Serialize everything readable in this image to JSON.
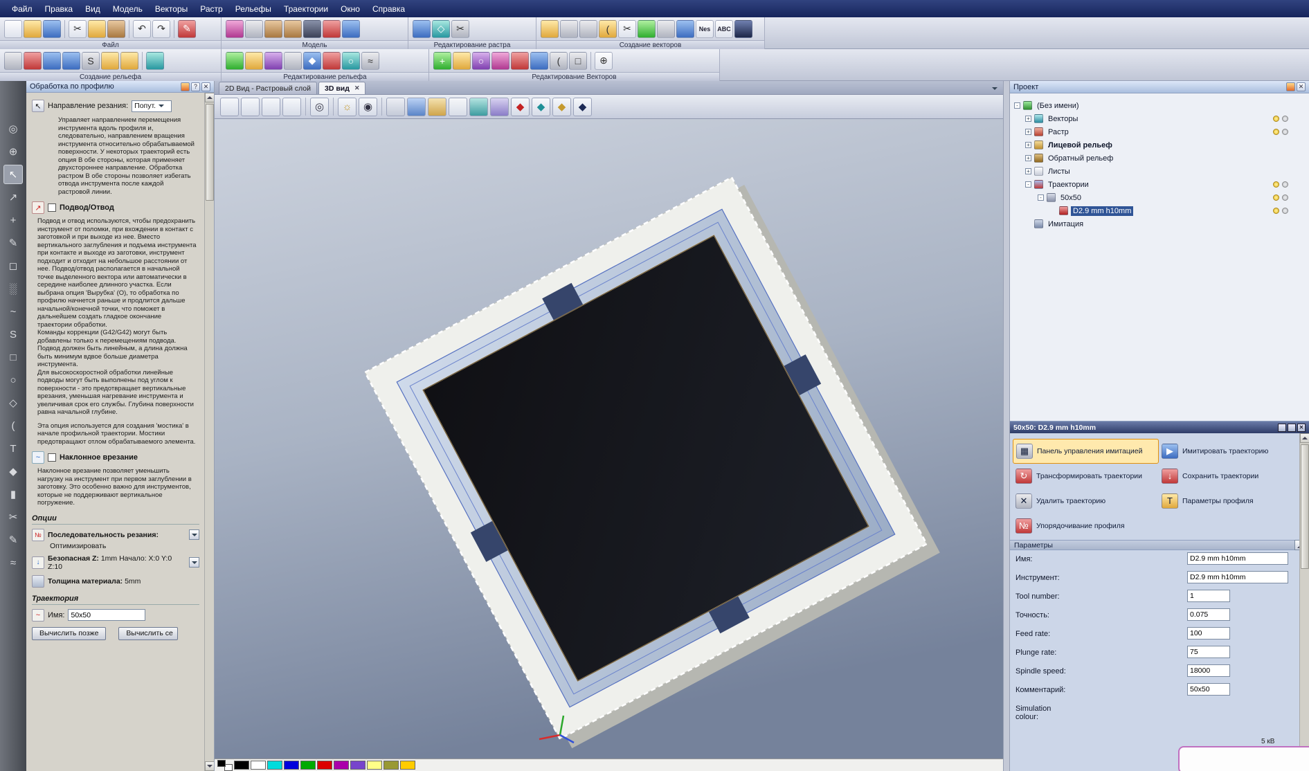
{
  "window": {
    "popup_text": "5 кВ"
  },
  "icons": {
    "close": "✕",
    "help": "?",
    "zoom": "◎",
    "orbit": "⊕",
    "select": "↖",
    "transform": "↗",
    "move": "+",
    "pencil": "✎",
    "eraser": "◻",
    "spray": "░",
    "freehand": "~",
    "spline": "S",
    "rect": "□",
    "circle": "○",
    "polygon": "◇",
    "arc": "(",
    "text": "T",
    "fill": "◆",
    "paint": "▮",
    "knife": "✂",
    "pen": "✎",
    "smooth": "≈",
    "undo": "↶",
    "redo": "↷",
    "cut": "✂",
    "bulb": "☼",
    "eye": "◉",
    "diamond": "◆",
    "sim_panel": "▦",
    "sim_play": "▶",
    "tp_transform": "↻",
    "tp_save": "↓",
    "tp_delete": "✕",
    "tp_params": "T",
    "tp_order": "№"
  },
  "menubar": {
    "items": [
      "Файл",
      "Правка",
      "Вид",
      "Модель",
      "Векторы",
      "Растр",
      "Рельефы",
      "Траектории",
      "Окно",
      "Справка"
    ]
  },
  "toolbar1": {
    "groups": [
      "Файл",
      "Модель",
      "Редактирование растра",
      "Создание векторов"
    ],
    "nesting_label": "Nes",
    "text_tool_label": "ABC"
  },
  "toolbar2": {
    "groups": [
      "Создание рельефа",
      "Редактирование рельефа",
      "Редактирование Векторов"
    ]
  },
  "left_panel": {
    "title": "Обработка по профилю",
    "direction_label": "Направление резания:",
    "direction_value": "Попут.",
    "help_direction": "Управляет направлением перемещения инструмента вдоль профиля и, следовательно, направлением вращения инструмента относительно обрабатываемой поверхности. У некоторых траекторий есть опция В обе стороны, которая применяет двухстороннее направление. Обработка растром В обе стороны позволяет избегать отвода инструмента после каждой растровой линии.",
    "lead_in_checkbox": "Подвод/Отвод",
    "help_lead_in": "Подвод и отвод используются, чтобы предохранить инструмент от поломки, при вхождении в контакт с заготовкой и при выходе из нее. Вместо вертикального заглубления и подъема инструмента при контакте и выходе из заготовки, инструмент подходит и отходит на небольшое расстоянии от нее. Подвод/отвод располагается в начальной точке выделенного вектора или автоматически в середине наиболее длинного участка. Если выбрана опция 'Вырубка' (O), то обработка по профилю начнется раньше и продлится дальше начальной/конечной точки, что поможет в дальнейшем создать гладкое окончание траектории обработки.\nКоманды коррекции (G42/G42) могут быть добавлены только к перемещениям подвода. Подвод должен быть линейным, а длина должна быть минимум вдвое больше диаметра инструмента.\nДля высокоскоростной обработки линейные подводы могут быть выполнены под углом к поверхности - это предотвращает вертикальные врезания, уменьшая нагревание инструмента и увеличивая срок его службы. Глубина поверхности равна начальной глубине.",
    "help_bridge": "Эта опция используется для создания 'мостика' в начале профильной траектории. Мостики предотвращают отлом обрабатываемого элемента.",
    "ramp_checkbox": "Наклонное врезание",
    "help_ramp": "Наклонное врезание позволяет уменьшить нагрузку на инструмент при первом заглублении в заготовку. Это особенно важно для инструментов, которые не поддерживают вертикальное погружение.",
    "options_header": "Опции",
    "order_label": "Последовательность резания:",
    "order_value": "Оптимизировать",
    "safez_label": "Безопасная Z:",
    "safez_value": "1mm Начало: X:0 Y:0 Z:10",
    "material_label": "Толщина материала:",
    "material_value": "5mm",
    "trajectory_header": "Траектория",
    "name_label": "Имя:",
    "name_value": "50x50",
    "calc_later": "Вычислить позже",
    "calc_now": "Вычислить се"
  },
  "viewport": {
    "tab_2d": "2D Вид - Растровый слой",
    "tab_3d": "3D вид",
    "palette": [
      "#000000",
      "#ffffff",
      "#00dcdc",
      "#0000dc",
      "#00aa00",
      "#dc0000",
      "#aa00aa",
      "#7744cc",
      "#ffff88",
      "#999933",
      "#ffcc00"
    ]
  },
  "project": {
    "title": "Проект",
    "items": [
      {
        "label": "(Без имени)",
        "exp": "-"
      },
      {
        "label": "Векторы",
        "exp": "+"
      },
      {
        "label": "Растр",
        "exp": "+"
      },
      {
        "label": "Лицевой рельеф",
        "exp": "+"
      },
      {
        "label": "Обратный рельеф",
        "exp": "+"
      },
      {
        "label": "Листы",
        "exp": "+"
      },
      {
        "label": "Траектории",
        "exp": "-"
      },
      {
        "label": "50x50",
        "exp": "-"
      },
      {
        "label": "D2.9 mm h10mm",
        "exp": ""
      },
      {
        "label": "Имитация",
        "exp": ""
      }
    ]
  },
  "toolpath_panel": {
    "title": "50x50: D2.9 mm h10mm",
    "buttons": [
      "Панель управления имитацией",
      "Имитировать траекторию",
      "Трансформировать траектории",
      "Сохранить траектории",
      "Удалить траекторию",
      "Параметры профиля",
      "Упорядочивание профиля"
    ],
    "params_header": "Параметры",
    "params": [
      {
        "label": "Имя:",
        "value": "D2.9 mm h10mm"
      },
      {
        "label": "Инструмент:",
        "value": "D2.9 mm h10mm"
      },
      {
        "label": "Tool number:",
        "value": "1"
      },
      {
        "label": "Точность:",
        "value": "0.075"
      },
      {
        "label": "Feed rate:",
        "value": "100"
      },
      {
        "label": "Plunge rate:",
        "value": "75"
      },
      {
        "label": "Spindle speed:",
        "value": "18000"
      },
      {
        "label": "Комментарий:",
        "value": "50x50"
      },
      {
        "label": "Simulation colour:",
        "value": ""
      }
    ]
  }
}
